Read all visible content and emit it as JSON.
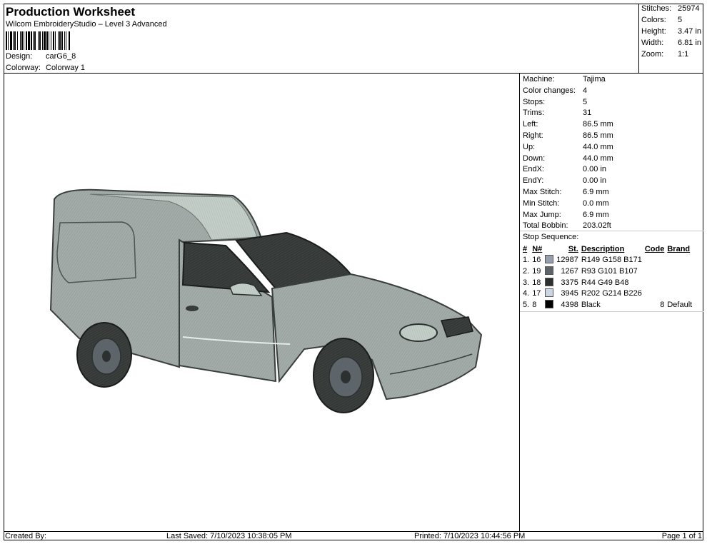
{
  "header": {
    "title": "Production Worksheet",
    "subtitle": "Wilcom EmbroideryStudio – Level 3 Advanced",
    "design_label": "Design:",
    "design_value": "carG6_8",
    "colorway_label": "Colorway:",
    "colorway_value": "Colorway 1"
  },
  "summary": {
    "stitches_label": "Stitches:",
    "stitches": "25974",
    "colors_label": "Colors:",
    "colors": "5",
    "height_label": "Height:",
    "height": "3.47 in",
    "width_label": "Width:",
    "width": "6.81 in",
    "zoom_label": "Zoom:",
    "zoom": "1:1"
  },
  "stats": [
    {
      "label": "Machine:",
      "value": "Tajima"
    },
    {
      "label": "Color changes:",
      "value": "4"
    },
    {
      "label": "Stops:",
      "value": "5"
    },
    {
      "label": "Trims:",
      "value": "31"
    },
    {
      "label": "Left:",
      "value": "86.5 mm"
    },
    {
      "label": "Right:",
      "value": "86.5 mm"
    },
    {
      "label": "Up:",
      "value": "44.0 mm"
    },
    {
      "label": "Down:",
      "value": "44.0 mm"
    },
    {
      "label": "EndX:",
      "value": "0.00 in"
    },
    {
      "label": "EndY:",
      "value": "0.00 in"
    },
    {
      "label": "Max Stitch:",
      "value": "6.9 mm"
    },
    {
      "label": "Min Stitch:",
      "value": "0.0 mm"
    },
    {
      "label": "Max Jump:",
      "value": "6.9 mm"
    },
    {
      "label": "Total Bobbin:",
      "value": "203.02ft"
    }
  ],
  "stop_sequence": {
    "title": "Stop Sequence:",
    "headers": {
      "num": "#",
      "needle": "N#",
      "stitches": "St.",
      "description": "Description",
      "code": "Code",
      "brand": "Brand"
    },
    "rows": [
      {
        "num": "1.",
        "needle": "16",
        "color": "#959EAB",
        "stitches": "12987",
        "description": "R149 G158 B171",
        "code": "",
        "brand": ""
      },
      {
        "num": "2.",
        "needle": "19",
        "color": "#5D656B",
        "stitches": "1267",
        "description": "R93 G101 B107",
        "code": "",
        "brand": ""
      },
      {
        "num": "3.",
        "needle": "18",
        "color": "#2C3130",
        "stitches": "3375",
        "description": "R44 G49 B48",
        "code": "",
        "brand": ""
      },
      {
        "num": "4.",
        "needle": "17",
        "color": "#CAD6E2",
        "stitches": "3945",
        "description": "R202 G214 B226",
        "code": "",
        "brand": ""
      },
      {
        "num": "5.",
        "needle": "8",
        "color": "#000000",
        "stitches": "4398",
        "description": "Black",
        "code": "8",
        "brand": "Default"
      }
    ]
  },
  "footer": {
    "created_by": "Created By:",
    "last_saved": "Last Saved: 7/10/2023 10:38:05 PM",
    "printed": "Printed: 7/10/2023 10:44:56 PM",
    "page": "Page 1 of 1"
  },
  "colors": {
    "body": "#9fa8a4",
    "body_light": "#c3cdc8",
    "glass_dark": "#2c3130",
    "tire": "#3a3f3d",
    "hub": "#5d656b"
  }
}
